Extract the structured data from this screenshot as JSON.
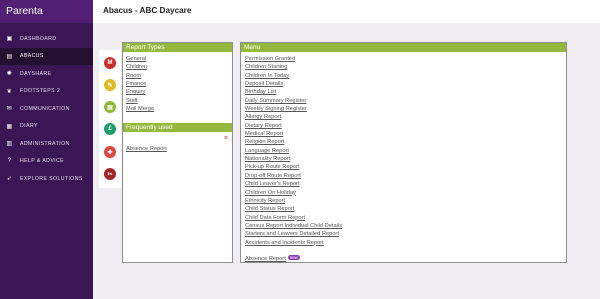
{
  "app": {
    "brand": "Parenta"
  },
  "header": {
    "title": "Abacus - ABC Daycare"
  },
  "sidebar": {
    "items": [
      {
        "label": "DASHBOARD",
        "icon": "dashboard-icon"
      },
      {
        "label": "ABACUS",
        "icon": "abacus-icon"
      },
      {
        "label": "DAYSHARE",
        "icon": "gear-icon"
      },
      {
        "label": "FOOTSTEPS 2",
        "icon": "footsteps-icon"
      },
      {
        "label": "COMMUNICATION",
        "icon": "envelope-icon"
      },
      {
        "label": "DIARY",
        "icon": "calendar-icon"
      },
      {
        "label": "ADMINISTRATION",
        "icon": "building-icon"
      },
      {
        "label": "HELP & ADVICE",
        "icon": "question-icon"
      },
      {
        "label": "EXPLORE SOLUTIONS",
        "icon": "rocket-icon"
      }
    ]
  },
  "report_types": {
    "title": "Report Types",
    "items": [
      "General",
      "Children",
      "Room",
      "Finance",
      "Enquiry",
      "Staff",
      "Mail Merge"
    ]
  },
  "icon_strip": {
    "icons": [
      {
        "name": "general-report-icon",
        "color": "#c9302c",
        "glyph": "M"
      },
      {
        "name": "children-report-icon",
        "color": "#e0b820",
        "glyph": "✎"
      },
      {
        "name": "room-report-icon",
        "color": "#8fb838",
        "glyph": "▤"
      },
      {
        "name": "finance-report-icon",
        "color": "#1f9c6f",
        "glyph": "£"
      },
      {
        "name": "enquiry-report-icon",
        "color": "#d9473f",
        "glyph": "✚"
      },
      {
        "name": "staff-report-icon",
        "color": "#a22626",
        "glyph": "✂"
      }
    ]
  },
  "frequently_used": {
    "title": "Frequently used",
    "items": [
      {
        "label": "Absence Report",
        "remove": "×"
      }
    ]
  },
  "menu": {
    "title": "Menu",
    "new_badge": "new",
    "items": [
      "Permission Granted",
      "Children Starting",
      "Children In Today",
      "Deposit Details",
      "Birthday List",
      "Daily Summary Register",
      "Weekly Signing Register",
      "Allergy Report",
      "Dietary Report",
      "Medical Report",
      "Religion Report",
      "Language Report",
      "Nationality Report",
      "Pick-up Route Report",
      "Drop-off Route Report",
      "Child Leaver's Report",
      "Children On Holiday",
      "Ethnicity Report",
      "Child Status Report",
      "Child Data Form Report",
      "Census Report Individual Child Details",
      "Starters and Leavers Detailed Report",
      "Accidents and Incidents Report",
      "Absence Report"
    ]
  }
}
